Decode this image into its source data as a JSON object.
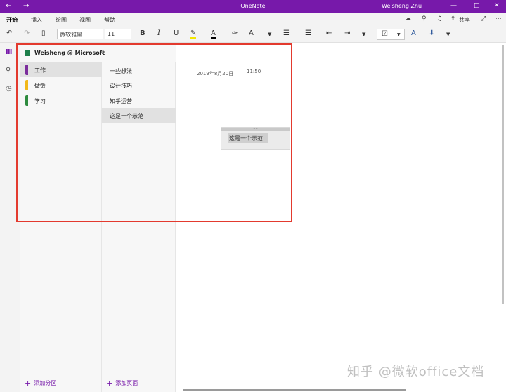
{
  "titlebar": {
    "app_title": "OneNote",
    "user": "Weisheng Zhu",
    "back_icon": "←",
    "forward_icon": "→",
    "minimize": "—",
    "maximize": "□",
    "close": "✕"
  },
  "menu": {
    "tabs": [
      "开始",
      "插入",
      "绘图",
      "视图",
      "帮助"
    ],
    "share": "共享"
  },
  "toolbar": {
    "font_name": "微软雅黑",
    "font_size": "11"
  },
  "notebook": {
    "name": "Weisheng @ Microsoft"
  },
  "sections": [
    {
      "label": "工作",
      "color": "#7b2d9c",
      "selected": true
    },
    {
      "label": "做饭",
      "color": "#f2b818",
      "selected": false
    },
    {
      "label": "学习",
      "color": "#2e8b3e",
      "selected": false
    }
  ],
  "pages": [
    {
      "label": "一些想法",
      "selected": false
    },
    {
      "label": "设计技巧",
      "selected": false
    },
    {
      "label": "知乎运营",
      "selected": false
    },
    {
      "label": "这是一个示范",
      "selected": true
    }
  ],
  "footer": {
    "add_section": "添加分区",
    "add_page": "添加页面"
  },
  "note": {
    "date": "2019年8月20日",
    "time": "11:50",
    "content": "这是一个示范"
  },
  "watermark": "知乎 @微软office文档",
  "colors": {
    "brand": "#7719aa",
    "highlight_border": "#e33a2e"
  }
}
